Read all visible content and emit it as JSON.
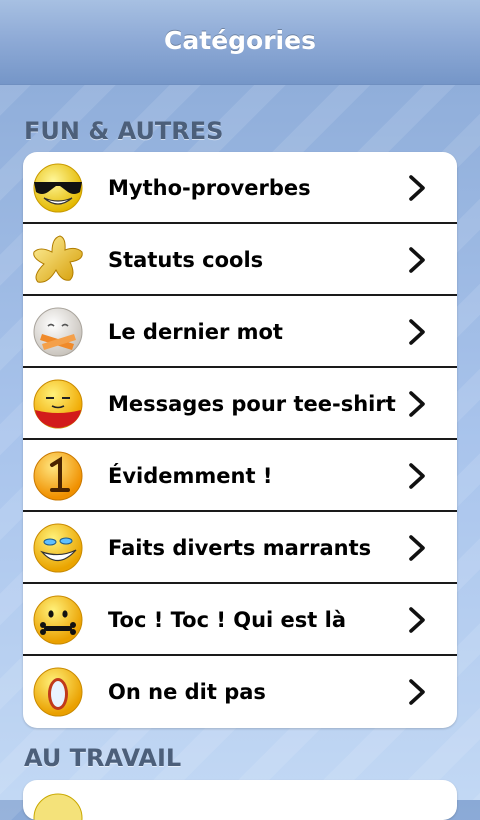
{
  "header": {
    "title": "Catégories"
  },
  "sections": [
    {
      "title": "FUN & AUTRES",
      "items": [
        {
          "label": "Mytho-proverbes",
          "icon": "sunglasses-smiley-icon"
        },
        {
          "label": "Statuts cools",
          "icon": "gold-star-icon"
        },
        {
          "label": "Le dernier mot",
          "icon": "taped-mouth-face-icon"
        },
        {
          "label": "Messages pour tee-shirt",
          "icon": "tshirt-smiley-icon"
        },
        {
          "label": "Évidemment !",
          "icon": "number-one-smiley-icon"
        },
        {
          "label": "Faits diverts marrants",
          "icon": "laughing-smiley-icon"
        },
        {
          "label": "Toc ! Toc ! Qui est là",
          "icon": "bone-mouth-smiley-icon"
        },
        {
          "label": "On ne dit pas",
          "icon": "mirror-smiley-icon"
        }
      ]
    },
    {
      "title": "AU TRAVAIL",
      "items": []
    }
  ],
  "colors": {
    "accent": "#7596c8",
    "section_header": "#4c5f7a"
  }
}
